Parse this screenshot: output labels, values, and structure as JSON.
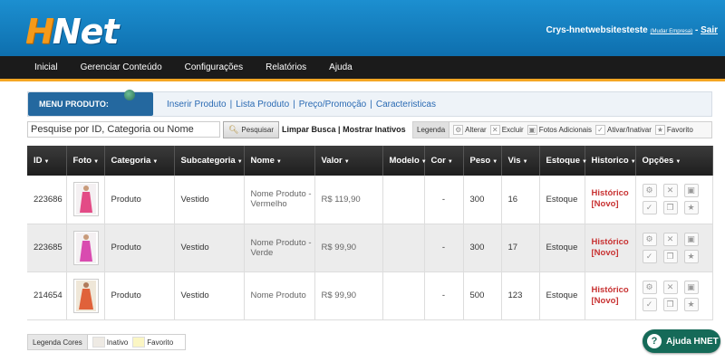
{
  "header": {
    "logo_h": "H",
    "logo_net": "Net",
    "user": "Crys-hnetwebsitesteste",
    "change_company": "(Mudar Empresa)",
    "separator": " - ",
    "logout": "Sair"
  },
  "nav": [
    "Inicial",
    "Gerenciar Conteúdo",
    "Configurações",
    "Relatórios",
    "Ajuda"
  ],
  "submenu": {
    "title": "MENU PRODUTO:",
    "links": [
      "Inserir Produto",
      "Lista Produto",
      "Preço/Promoção",
      "Caracteristicas"
    ],
    "sep": "|"
  },
  "search": {
    "value": "Pesquise por ID, Categoria ou Nome",
    "button": "Pesquisar",
    "clear": "Limpar Busca",
    "sep": "|",
    "show_inactive": "Mostrar Inativos"
  },
  "legend": {
    "title": "Legenda",
    "items": [
      "Alterar",
      "Excluir",
      "Fotos Adicionais",
      "Ativar/Inativar",
      "Favorito"
    ]
  },
  "table": {
    "columns": [
      "ID",
      "Foto",
      "Categoria",
      "Subcategoria",
      "Nome",
      "Valor",
      "Modelo",
      "Cor",
      "Peso",
      "Vis",
      "Estoque",
      "Historico",
      "Opções"
    ],
    "rows": [
      {
        "id": "223686",
        "categoria": "Produto",
        "subcategoria": "Vestido",
        "nome": "Nome Produto - Vermelho",
        "valor": "R$ 119,90",
        "modelo": "",
        "cor": "-",
        "peso": "300",
        "vis": "16",
        "estoque": "Estoque",
        "hist1": "Histórico",
        "hist2": "[Novo]",
        "photo_color": "#e34b86"
      },
      {
        "id": "223685",
        "categoria": "Produto",
        "subcategoria": "Vestido",
        "nome": "Nome Produto - Verde",
        "valor": "R$ 99,90",
        "modelo": "",
        "cor": "-",
        "peso": "300",
        "vis": "17",
        "estoque": "Estoque",
        "hist1": "Histórico",
        "hist2": "[Novo]",
        "photo_color": "#d94bb0"
      },
      {
        "id": "214654",
        "categoria": "Produto",
        "subcategoria": "Vestido",
        "nome": "Nome Produto",
        "valor": "R$ 99,90",
        "modelo": "",
        "cor": "-",
        "peso": "500",
        "vis": "123",
        "estoque": "Estoque",
        "hist1": "Histórico",
        "hist2": "[Novo]",
        "photo_color": "#e0623a"
      }
    ]
  },
  "legend_colors": {
    "title": "Legenda Cores",
    "items": [
      {
        "label": "Inativo",
        "color": "#eeeae4"
      },
      {
        "label": "Favorito",
        "color": "#fbf6c4"
      }
    ]
  },
  "help_button": "Ajuda HNET",
  "colors": {
    "header_blue": "#1c8fd0",
    "nav_accent": "#f5a623",
    "link_blue": "#2a6ab3",
    "history_red": "#c83232",
    "help_green": "#156a58"
  }
}
